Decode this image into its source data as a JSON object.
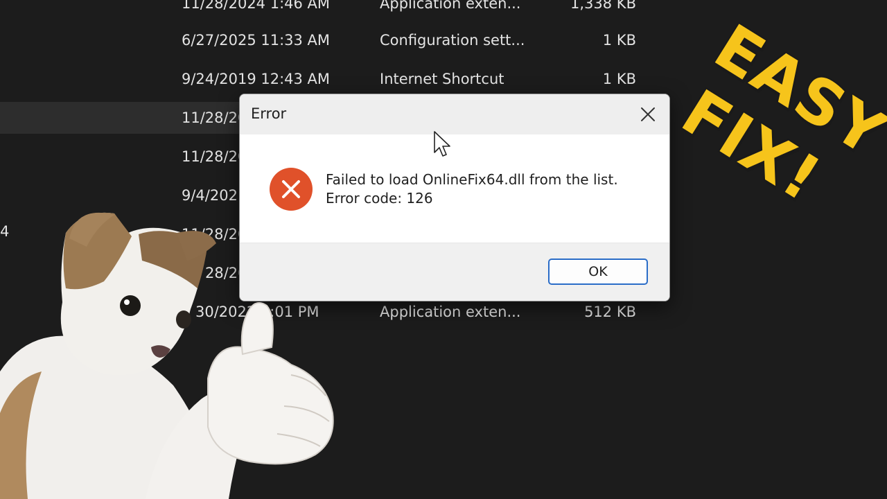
{
  "file_list": [
    {
      "date": "11/28/2024 1:46 AM",
      "type": "Application exten...",
      "size": "1,338 KB"
    },
    {
      "date": "6/27/2025 11:33 AM",
      "type": "Configuration sett...",
      "size": "1 KB"
    },
    {
      "date": "9/24/2019 12:43 AM",
      "type": "Internet Shortcut",
      "size": "1 KB"
    },
    {
      "date": "11/28/20",
      "type": "",
      "size": ""
    },
    {
      "date": "11/28/20",
      "type": "",
      "size": ""
    },
    {
      "date": "9/4/202",
      "type": "",
      "size": ""
    },
    {
      "date": "11/28/20",
      "type": "",
      "size": ""
    },
    {
      "date": "28/20",
      "type": "",
      "size": ""
    },
    {
      "date": "30/2022 5:01 PM",
      "type": "Application exten...",
      "size": "512 KB"
    }
  ],
  "stray_text": "4",
  "dialog": {
    "title": "Error",
    "message_line1": "Failed to load OnlineFix64.dll from the list.",
    "message_line2": "Error code: 126",
    "ok_label": "OK"
  },
  "overlay": {
    "line1": "EASY",
    "line2": "FIX!",
    "color": "#f6c41b"
  },
  "icons": {
    "error": "error-circle-icon",
    "close": "close-icon",
    "cursor": "mouse-pointer-icon"
  },
  "colors": {
    "error_red": "#e0512a",
    "dialog_bg": "#ffffff",
    "button_border": "#2a6cc7"
  }
}
